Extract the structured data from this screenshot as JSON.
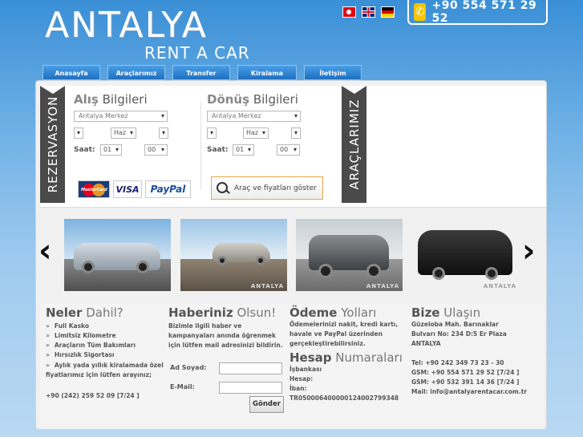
{
  "header": {
    "logo_main": "ANTALYA",
    "logo_sub": "RENT A CAR",
    "phone": "+90 554 571 29 52"
  },
  "flags": [
    "turkish-flag-icon",
    "uk-flag-icon",
    "german-flag-icon"
  ],
  "nav": [
    {
      "label": "Anasayfa"
    },
    {
      "label": "Araçlarımız"
    },
    {
      "label": "Transfer"
    },
    {
      "label": "Kiralama Şartları"
    },
    {
      "label": "İletişim"
    }
  ],
  "reservation": {
    "ribbon_left": "REZERVASYON",
    "ribbon_right": "ARAÇLARIMIZ",
    "pickup": {
      "title_bold": "Alış",
      "title_rest": " Bilgileri",
      "location": "Antalya Merkez",
      "month": "Haz",
      "hour": "01",
      "minute": "00"
    },
    "dropoff": {
      "title_bold": "Dönüş",
      "title_rest": " Bilgileri",
      "location": "Antalya Merkez",
      "month": "Haz",
      "hour": "01",
      "minute": "00"
    },
    "saat_label": "Saat:",
    "search_button": "Araç ve fiyatları göster",
    "cards": {
      "mastercard": "MasterCard",
      "visa": "VISA",
      "paypal": "PayPal"
    }
  },
  "gallery": {
    "watermark": "ANTALYA"
  },
  "neler": {
    "title_bold": "Neler",
    "title_rest": " Dahil?",
    "items": [
      "Full Kasko",
      "Limitsiz Kilometre",
      "Araçların Tüm Bakımları",
      "Hırsızlık Sigortası"
    ],
    "extra": "Aylık yada yıllık kiralamada özel fiyatlarımız için lütfen arayınız;",
    "phone": "+90 (242) 259 52 09 [7/24 ]"
  },
  "haber": {
    "title_bold": "Haberiniz",
    "title_rest": " Olsun!",
    "text": "Bizimle ilgili haber ve kampanyaları anında öğrenmek için lütfen mail adresinizi bildirin.",
    "name_label": "Ad Soyad:",
    "email_label": "E-Mail:",
    "submit": "Gönder"
  },
  "odeme": {
    "title_bold": "Ödeme",
    "title_rest": " Yolları",
    "text": "Ödemelerinizi nakit, kredi kartı, havale ve PayPal üzerinden gerçekleştirebilirsiniz.",
    "hesap_title_bold": "Hesap",
    "hesap_title_rest": " Numaraları",
    "bank": "İşbankası",
    "hesap": "Hesap:",
    "iban": "İban:",
    "iban_number": "TR050006400000124002799348"
  },
  "bize": {
    "title_bold": "Bize",
    "title_rest": " Ulaşın",
    "address1": "Güzeloba Mah. Barınaklar",
    "address2": "Bulvarı No: 234 D:5 Er Plaza",
    "city": "ANTALYA",
    "tel": "Tel: +90 242 349 73 23 - 30",
    "gsm1": "GSM: +90 554 571 29 52 [7/24 ]",
    "gsm2": "GSM: +90 532 391 14 36 [7/24 ]",
    "mail": "Mail: info@antalyarentacar.com.tr"
  }
}
